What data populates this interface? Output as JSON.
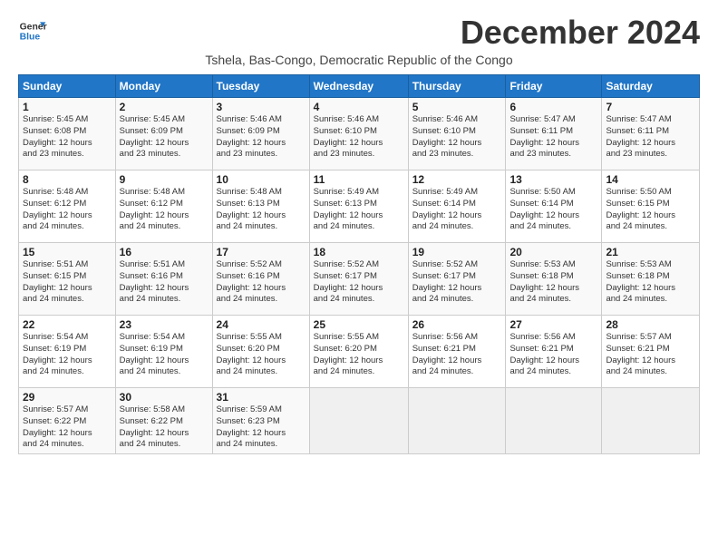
{
  "logo": {
    "line1": "General",
    "line2": "Blue"
  },
  "title": "December 2024",
  "subtitle": "Tshela, Bas-Congo, Democratic Republic of the Congo",
  "headers": [
    "Sunday",
    "Monday",
    "Tuesday",
    "Wednesday",
    "Thursday",
    "Friday",
    "Saturday"
  ],
  "weeks": [
    [
      {
        "day": "1",
        "info": "Sunrise: 5:45 AM\nSunset: 6:08 PM\nDaylight: 12 hours\nand 23 minutes."
      },
      {
        "day": "2",
        "info": "Sunrise: 5:45 AM\nSunset: 6:09 PM\nDaylight: 12 hours\nand 23 minutes."
      },
      {
        "day": "3",
        "info": "Sunrise: 5:46 AM\nSunset: 6:09 PM\nDaylight: 12 hours\nand 23 minutes."
      },
      {
        "day": "4",
        "info": "Sunrise: 5:46 AM\nSunset: 6:10 PM\nDaylight: 12 hours\nand 23 minutes."
      },
      {
        "day": "5",
        "info": "Sunrise: 5:46 AM\nSunset: 6:10 PM\nDaylight: 12 hours\nand 23 minutes."
      },
      {
        "day": "6",
        "info": "Sunrise: 5:47 AM\nSunset: 6:11 PM\nDaylight: 12 hours\nand 23 minutes."
      },
      {
        "day": "7",
        "info": "Sunrise: 5:47 AM\nSunset: 6:11 PM\nDaylight: 12 hours\nand 23 minutes."
      }
    ],
    [
      {
        "day": "8",
        "info": "Sunrise: 5:48 AM\nSunset: 6:12 PM\nDaylight: 12 hours\nand 24 minutes."
      },
      {
        "day": "9",
        "info": "Sunrise: 5:48 AM\nSunset: 6:12 PM\nDaylight: 12 hours\nand 24 minutes."
      },
      {
        "day": "10",
        "info": "Sunrise: 5:48 AM\nSunset: 6:13 PM\nDaylight: 12 hours\nand 24 minutes."
      },
      {
        "day": "11",
        "info": "Sunrise: 5:49 AM\nSunset: 6:13 PM\nDaylight: 12 hours\nand 24 minutes."
      },
      {
        "day": "12",
        "info": "Sunrise: 5:49 AM\nSunset: 6:14 PM\nDaylight: 12 hours\nand 24 minutes."
      },
      {
        "day": "13",
        "info": "Sunrise: 5:50 AM\nSunset: 6:14 PM\nDaylight: 12 hours\nand 24 minutes."
      },
      {
        "day": "14",
        "info": "Sunrise: 5:50 AM\nSunset: 6:15 PM\nDaylight: 12 hours\nand 24 minutes."
      }
    ],
    [
      {
        "day": "15",
        "info": "Sunrise: 5:51 AM\nSunset: 6:15 PM\nDaylight: 12 hours\nand 24 minutes."
      },
      {
        "day": "16",
        "info": "Sunrise: 5:51 AM\nSunset: 6:16 PM\nDaylight: 12 hours\nand 24 minutes."
      },
      {
        "day": "17",
        "info": "Sunrise: 5:52 AM\nSunset: 6:16 PM\nDaylight: 12 hours\nand 24 minutes."
      },
      {
        "day": "18",
        "info": "Sunrise: 5:52 AM\nSunset: 6:17 PM\nDaylight: 12 hours\nand 24 minutes."
      },
      {
        "day": "19",
        "info": "Sunrise: 5:52 AM\nSunset: 6:17 PM\nDaylight: 12 hours\nand 24 minutes."
      },
      {
        "day": "20",
        "info": "Sunrise: 5:53 AM\nSunset: 6:18 PM\nDaylight: 12 hours\nand 24 minutes."
      },
      {
        "day": "21",
        "info": "Sunrise: 5:53 AM\nSunset: 6:18 PM\nDaylight: 12 hours\nand 24 minutes."
      }
    ],
    [
      {
        "day": "22",
        "info": "Sunrise: 5:54 AM\nSunset: 6:19 PM\nDaylight: 12 hours\nand 24 minutes."
      },
      {
        "day": "23",
        "info": "Sunrise: 5:54 AM\nSunset: 6:19 PM\nDaylight: 12 hours\nand 24 minutes."
      },
      {
        "day": "24",
        "info": "Sunrise: 5:55 AM\nSunset: 6:20 PM\nDaylight: 12 hours\nand 24 minutes."
      },
      {
        "day": "25",
        "info": "Sunrise: 5:55 AM\nSunset: 6:20 PM\nDaylight: 12 hours\nand 24 minutes."
      },
      {
        "day": "26",
        "info": "Sunrise: 5:56 AM\nSunset: 6:21 PM\nDaylight: 12 hours\nand 24 minutes."
      },
      {
        "day": "27",
        "info": "Sunrise: 5:56 AM\nSunset: 6:21 PM\nDaylight: 12 hours\nand 24 minutes."
      },
      {
        "day": "28",
        "info": "Sunrise: 5:57 AM\nSunset: 6:21 PM\nDaylight: 12 hours\nand 24 minutes."
      }
    ],
    [
      {
        "day": "29",
        "info": "Sunrise: 5:57 AM\nSunset: 6:22 PM\nDaylight: 12 hours\nand 24 minutes."
      },
      {
        "day": "30",
        "info": "Sunrise: 5:58 AM\nSunset: 6:22 PM\nDaylight: 12 hours\nand 24 minutes."
      },
      {
        "day": "31",
        "info": "Sunrise: 5:59 AM\nSunset: 6:23 PM\nDaylight: 12 hours\nand 24 minutes."
      },
      {
        "day": "",
        "info": ""
      },
      {
        "day": "",
        "info": ""
      },
      {
        "day": "",
        "info": ""
      },
      {
        "day": "",
        "info": ""
      }
    ]
  ]
}
